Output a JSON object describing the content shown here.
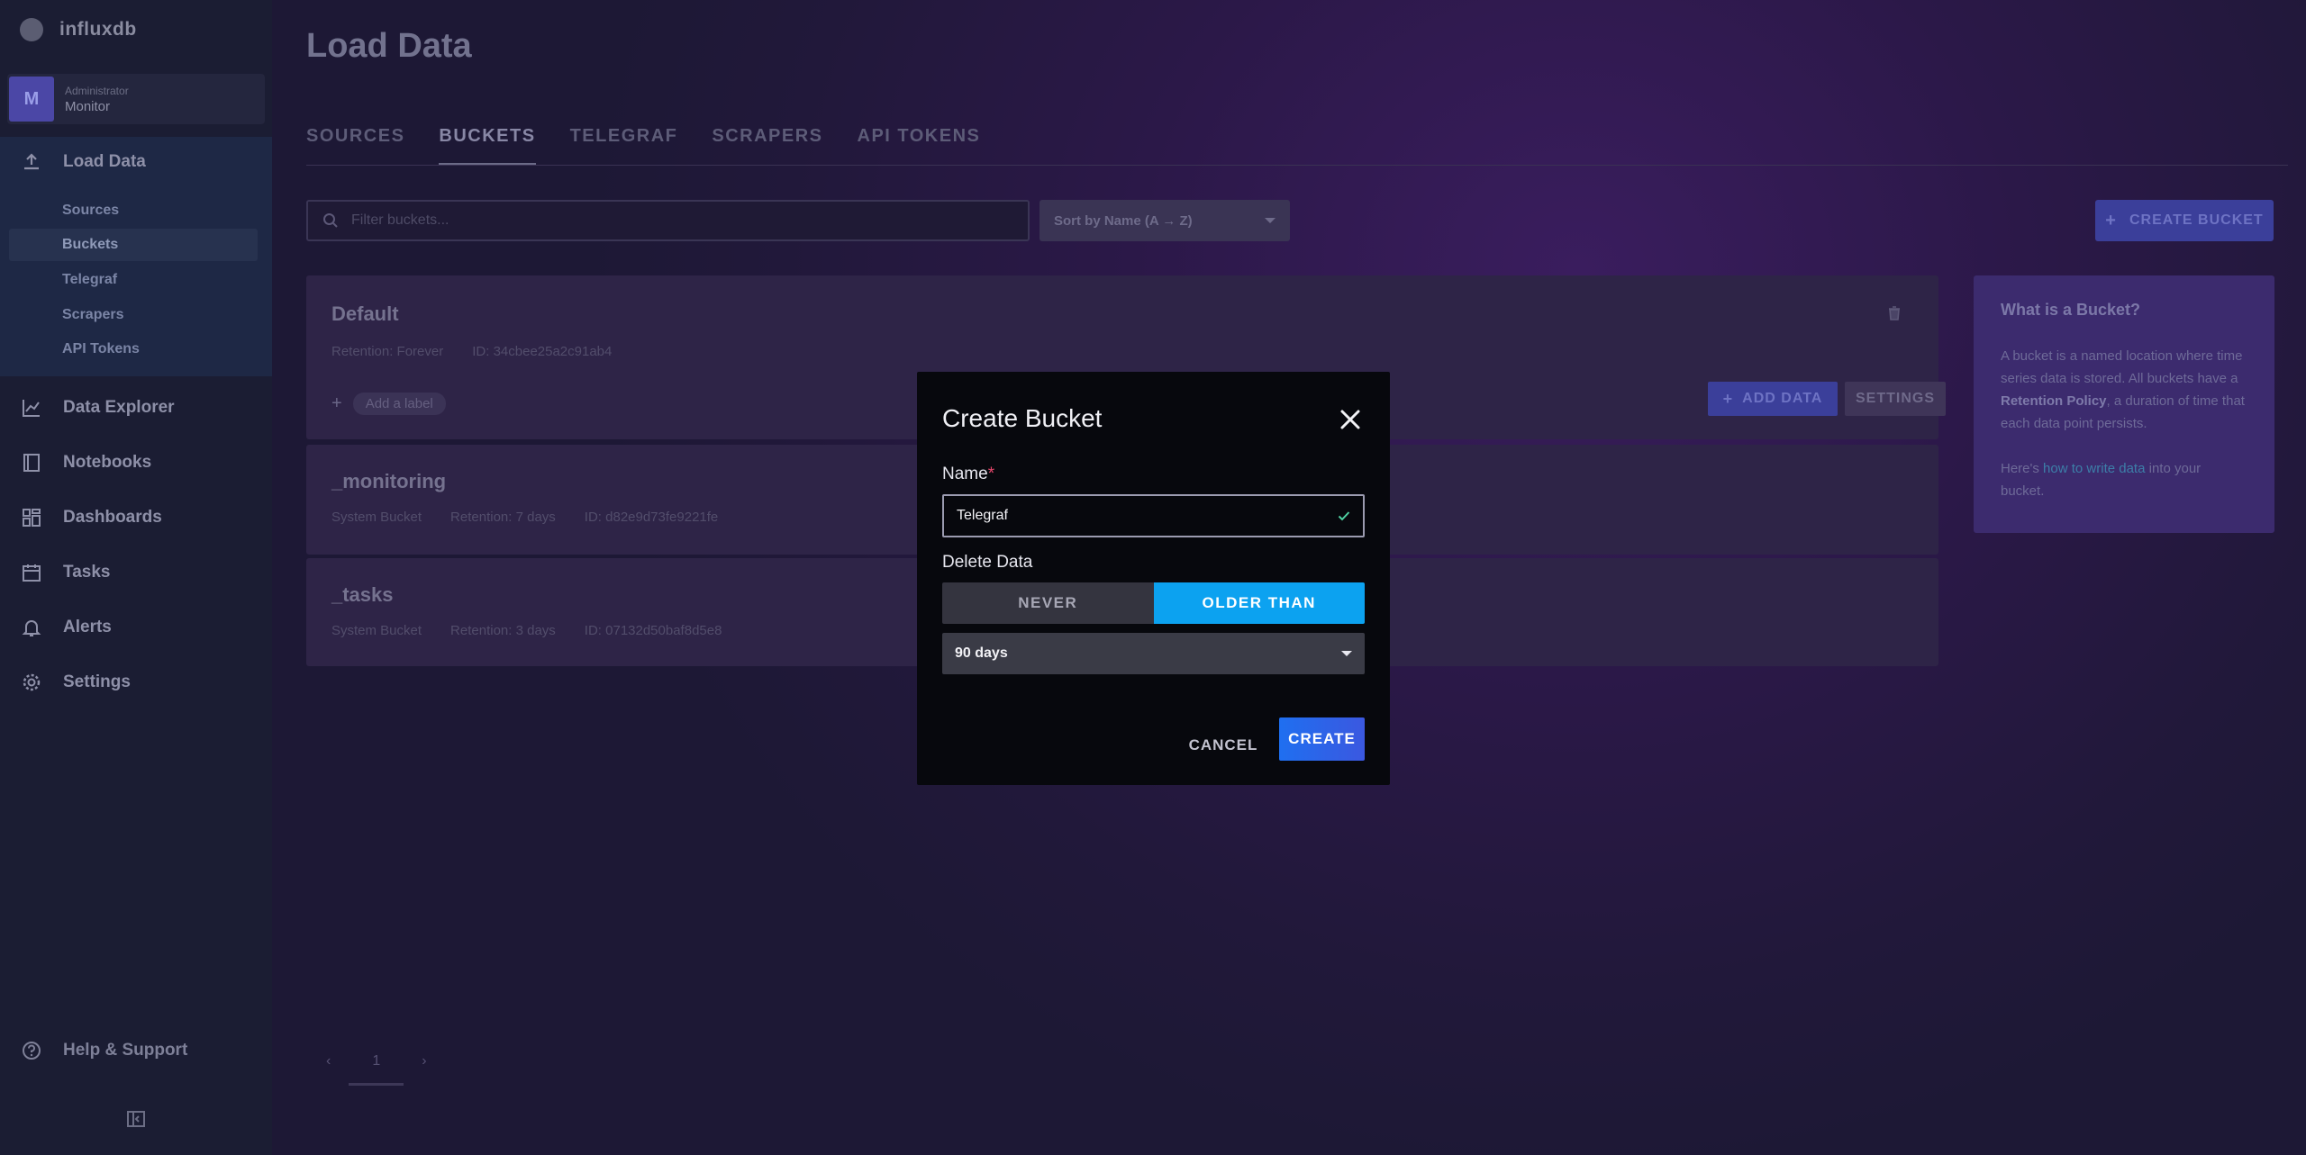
{
  "brand": {
    "name": "influxdb"
  },
  "org": {
    "avatar_letter": "M",
    "role": "Administrator",
    "name": "Monitor"
  },
  "sidebar": {
    "load_data": "Load Data",
    "subitems": [
      "Sources",
      "Buckets",
      "Telegraf",
      "Scrapers",
      "API Tokens"
    ],
    "active_subitem": "Buckets",
    "items": [
      "Data Explorer",
      "Notebooks",
      "Dashboards",
      "Tasks",
      "Alerts",
      "Settings"
    ],
    "help": "Help & Support"
  },
  "page": {
    "title": "Load Data",
    "tabs": [
      "SOURCES",
      "BUCKETS",
      "TELEGRAF",
      "SCRAPERS",
      "API TOKENS"
    ],
    "active_tab": "BUCKETS",
    "filter_placeholder": "Filter buckets...",
    "sort_label": "Sort by Name (A → Z)",
    "create_bucket": "CREATE BUCKET"
  },
  "buckets": [
    {
      "name": "Default",
      "meta": [
        "Retention: Forever",
        "ID: 34cbee25a2c91ab4"
      ],
      "add_label": "Add a label",
      "add_data": "ADD DATA",
      "settings": "SETTINGS"
    },
    {
      "name": "_monitoring",
      "meta": [
        "System Bucket",
        "Retention: 7 days",
        "ID: d82e9d73fe9221fe"
      ]
    },
    {
      "name": "_tasks",
      "meta": [
        "System Bucket",
        "Retention: 3 days",
        "ID: 07132d50baf8d5e8"
      ]
    }
  ],
  "info": {
    "title": "What is a Bucket?",
    "p1_a": "A bucket is a named location where time series data is stored. All buckets have a ",
    "p1_b": "Retention Policy",
    "p1_c": ", a duration of time that each data point persists.",
    "p2_a": "Here's ",
    "p2_link": "how to write data",
    "p2_b": " into your bucket."
  },
  "pager": {
    "current": "1"
  },
  "modal": {
    "title": "Create Bucket",
    "name_label": "Name",
    "required_mark": "*",
    "name_value": "Telegraf",
    "delete_label": "Delete Data",
    "never": "NEVER",
    "older_than": "OLDER THAN",
    "selected_mode": "OLDER THAN",
    "duration": "90 days",
    "cancel": "CANCEL",
    "create": "CREATE"
  },
  "colors": {
    "accent": "#0ca2f0",
    "primary": "#1f6ff0",
    "check": "#4fd1a3",
    "required": "#e5476b"
  }
}
